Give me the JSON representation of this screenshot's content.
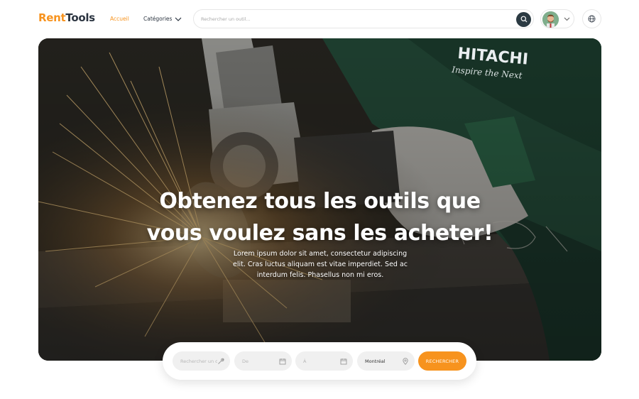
{
  "brand": {
    "part1": "Rent",
    "part2": "Tools"
  },
  "nav": {
    "home": "Accueil",
    "categories": "Catégories"
  },
  "search": {
    "placeholder": "Rechercher un outil..."
  },
  "hero": {
    "title_line1": "Obtenez tous les outils que",
    "title_line2": "vous voulez sans les acheter!",
    "description": "Lorem ipsum dolor sit amet, consectetur adipiscing elit. Cras luctus aliquam est vitae imperdiet. Sed ac interdum felis. Phasellus non mi eros.",
    "tool_brand": "HITACHI",
    "tool_slogan": "Inspire the Next"
  },
  "booking": {
    "tool_placeholder": "Rechercher un outil",
    "from_label": "De",
    "to_label": "À",
    "city": "Montréal",
    "submit": "RECHERCHER"
  },
  "colors": {
    "accent": "#f7931e",
    "dark": "#2b3440",
    "search_button": "#2b3a42"
  },
  "icons": [
    "chevron-down-icon",
    "search-icon",
    "user-avatar",
    "globe-icon",
    "wrench-icon",
    "calendar-icon",
    "location-pin-icon"
  ]
}
